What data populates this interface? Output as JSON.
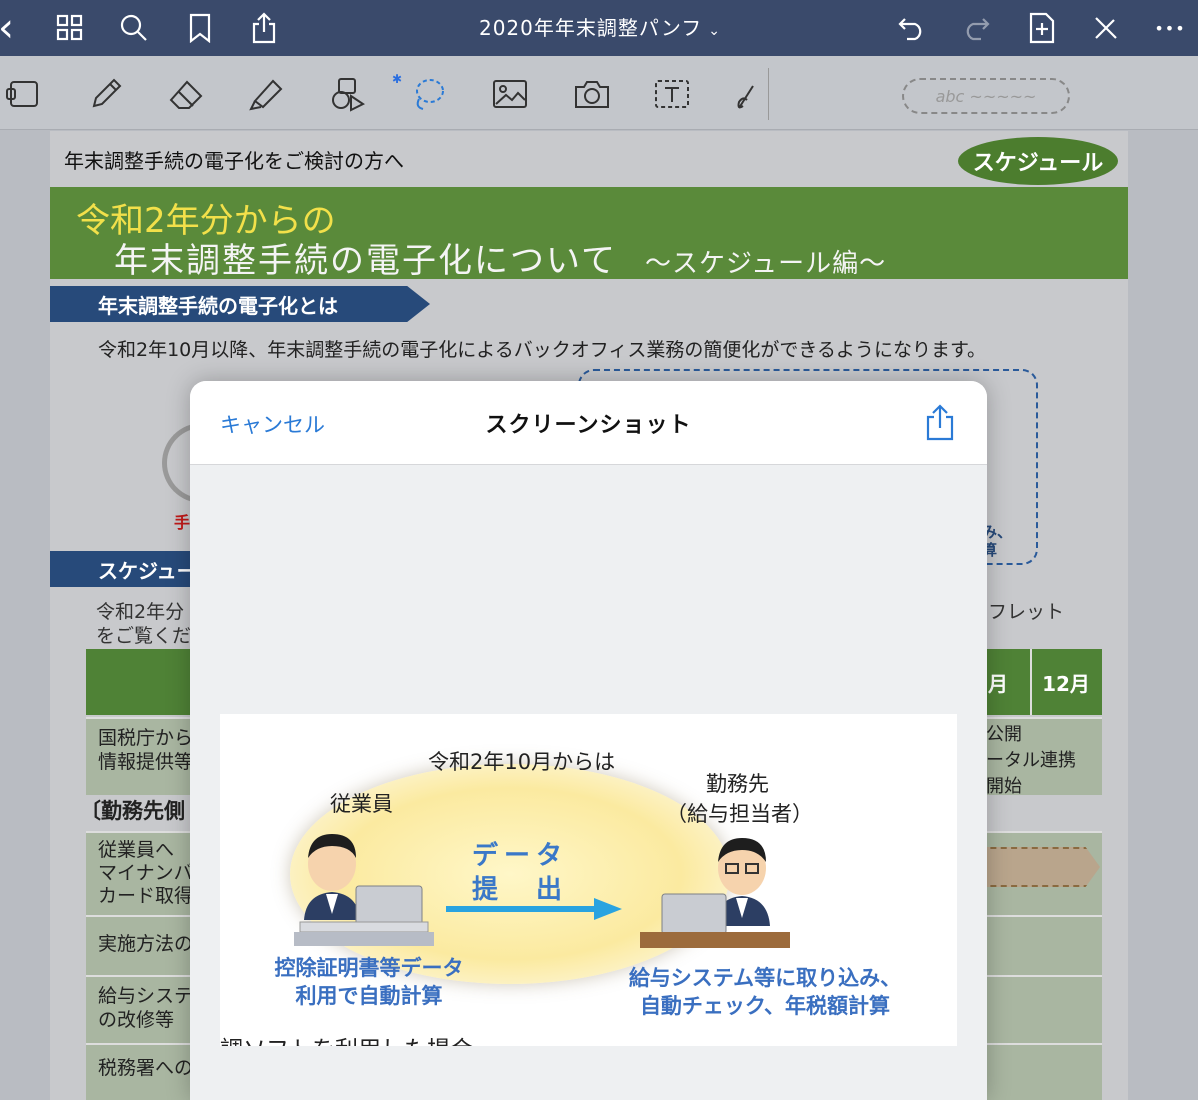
{
  "topbar": {
    "doc_title": "2020年年末調整パンフ",
    "title_chevron": "⌄",
    "back_glyph": "‹",
    "more_glyph": "•••"
  },
  "toolbar": {
    "handwriting_placeholder": "abc ~~~~~",
    "bluetooth_glyph": "✱"
  },
  "page": {
    "header": "年末調整手続の電子化をご検討の方へ",
    "schedule_badge": "スケジュール",
    "banner_line1": "令和2年分からの",
    "banner_line2": "年末調整手続の電子化について",
    "banner_sub": "～スケジュール編～",
    "section1": "年末調整手続の電子化とは",
    "intro": "令和2年10月以降、年末調整手続の電子化によるバックオフィス業務の簡便化ができるようになります。",
    "frag_top": "…",
    "frag_red": "手",
    "frag_right1": "み、",
    "frag_right2": "算",
    "section2": "スケジュー",
    "desc_left1": "令和2年分",
    "desc_left2": "をご覧くだ",
    "desc_right": "フレット",
    "months": [
      "月",
      "12月"
    ],
    "row1_label1": "国税庁から",
    "row1_label2": "情報提供等",
    "row1_right1": "公開",
    "row1_right2": "ータル連携",
    "row1_right3": "開始",
    "bracket": "〔勤務先側",
    "row2_label1": "従業員へ",
    "row2_label2": "マイナンバ",
    "row2_label3": "カード取得",
    "row3_label": "実施方法の",
    "row4_label1": "給与システ",
    "row4_label2": "の改修等",
    "row5_label": "税務署への"
  },
  "modal": {
    "cancel": "キャンセル",
    "title": "スクリーンショット"
  },
  "shot": {
    "heading": "令和2年10月からは",
    "employee": "従業員",
    "employer_l1": "勤務先",
    "employer_l2": "（給与担当者）",
    "data_l1": "データ",
    "data_l2": "提　出",
    "left_caption_l1": "控除証明書等データ",
    "left_caption_l2": "利用で自動計算",
    "right_caption_l1": "給与システム等に取り込み、",
    "right_caption_l2": "自動チェック、年税額計算",
    "clipped_text": "調ソフトを利用した場合"
  },
  "colors": {
    "nav": "#3a4a6b",
    "banner_green": "#5a8a3a",
    "section_navy": "#274a7a",
    "ios_blue": "#2a7ad6",
    "arrow_blue": "#29a3e0"
  }
}
